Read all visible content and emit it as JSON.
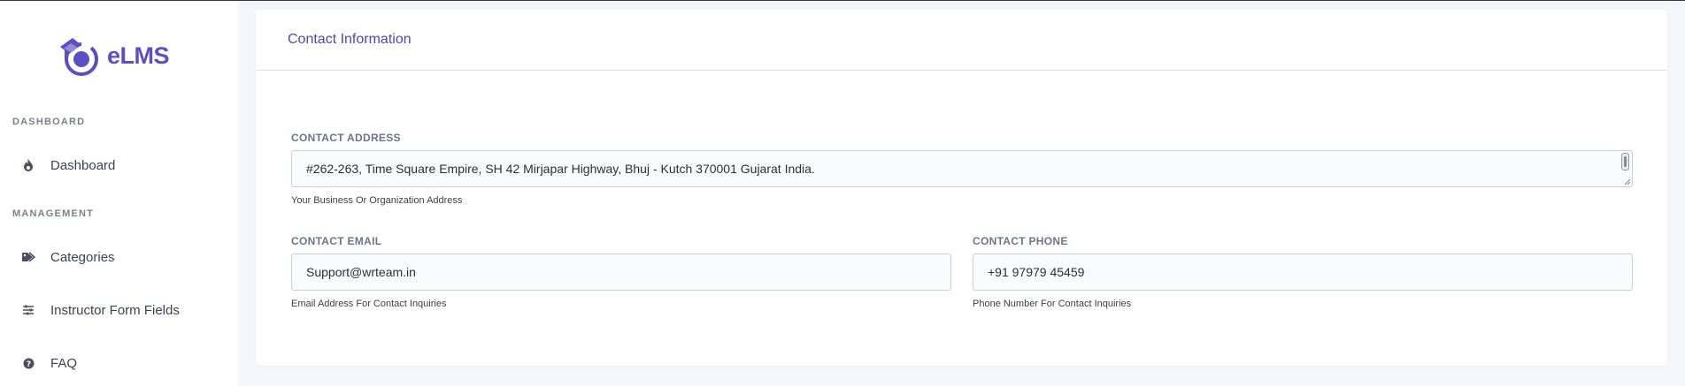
{
  "app": {
    "logo_text": "eLMS"
  },
  "sidebar": {
    "sections": [
      {
        "title": "DASHBOARD"
      },
      {
        "title": "MANAGEMENT"
      }
    ],
    "items": [
      {
        "label": "Dashboard",
        "icon": "fire-icon"
      },
      {
        "label": "Categories",
        "icon": "tags-icon"
      },
      {
        "label": "Instructor Form Fields",
        "icon": "sliders-icon"
      },
      {
        "label": "FAQ",
        "icon": "question-circle-icon"
      }
    ]
  },
  "card": {
    "title": "Contact Information",
    "address": {
      "label": "CONTACT ADDRESS",
      "value": "#262-263, Time Square Empire, SH 42 Mirjapar Highway, Bhuj - Kutch 370001 Gujarat India.",
      "help": "Your Business Or Organization Address"
    },
    "email": {
      "label": "CONTACT EMAIL",
      "value": "Support@wrteam.in",
      "help": "Email Address For Contact Inquiries"
    },
    "phone": {
      "label": "CONTACT PHONE",
      "value": "+91 97979 45459",
      "help": "Phone Number For Contact Inquiries"
    }
  },
  "colors": {
    "brand": "#5b4fc4",
    "title": "#4e45b8",
    "background": "#f4f6f9"
  }
}
